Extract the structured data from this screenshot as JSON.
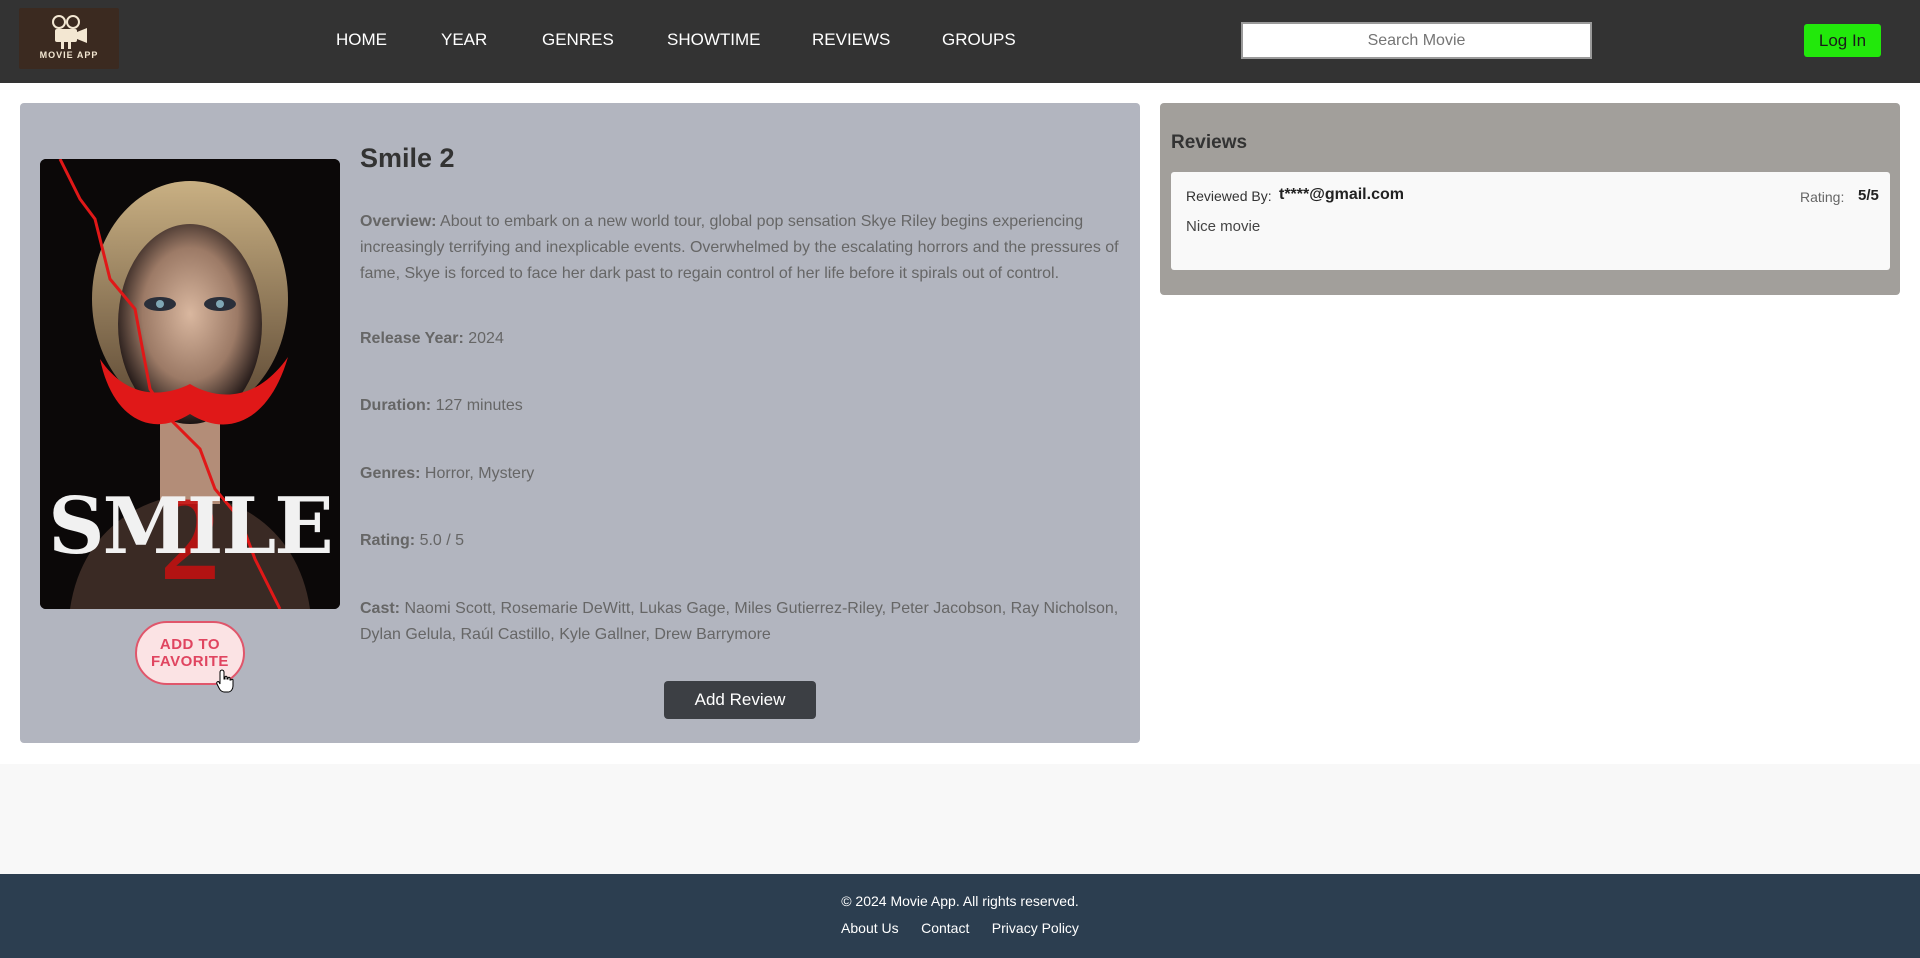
{
  "header": {
    "logo_text": "MOVIE APP",
    "nav": [
      {
        "label": "HOME"
      },
      {
        "label": "YEAR"
      },
      {
        "label": "GENRES"
      },
      {
        "label": "SHOWTIME"
      },
      {
        "label": "REVIEWS"
      },
      {
        "label": "GROUPS"
      }
    ],
    "search_placeholder": "Search Movie",
    "login_label": "Log In"
  },
  "movie": {
    "poster_title": "SMILE",
    "poster_number": "2",
    "title": "Smile 2",
    "overview_label": "Overview:",
    "overview": "About to embark on a new world tour, global pop sensation Skye Riley begins experiencing increasingly terrifying and inexplicable events. Overwhelmed by the escalating horrors and the pressures of fame, Skye is forced to face her dark past to regain control of her life before it spirals out of control.",
    "release_label": "Release Year:",
    "release_year": "2024",
    "duration_label": "Duration:",
    "duration": "127 minutes",
    "genres_label": "Genres:",
    "genres": "Horror, Mystery",
    "rating_label": "Rating:",
    "rating": "5.0 / 5",
    "cast_label": "Cast:",
    "cast": "Naomi Scott, Rosemarie DeWitt, Lukas Gage, Miles Gutierrez-Riley, Peter Jacobson, Ray Nicholson, Dylan Gelula, Raúl Castillo, Kyle Gallner, Drew Barrymore",
    "favorite_line1": "ADD TO",
    "favorite_line2": "FAVORITE",
    "add_review_label": "Add Review"
  },
  "reviews": {
    "title": "Reviews",
    "items": [
      {
        "reviewed_by_label": "Reviewed By:",
        "email": "t****@gmail.com",
        "rating_label": "Rating:",
        "rating": "5/5",
        "text": "Nice movie"
      }
    ]
  },
  "footer": {
    "copyright": "© 2024 Movie App. All rights reserved.",
    "links": [
      {
        "label": "About Us"
      },
      {
        "label": "Contact"
      },
      {
        "label": "Privacy Policy"
      }
    ]
  },
  "colors": {
    "header_bg": "#333333",
    "login_accent": "#22e80b",
    "movie_panel_bg": "#b2b5bf",
    "reviews_panel_bg": "#a29f9b",
    "footer_bg": "#2c3e50",
    "favorite_accent": "#e04560"
  }
}
